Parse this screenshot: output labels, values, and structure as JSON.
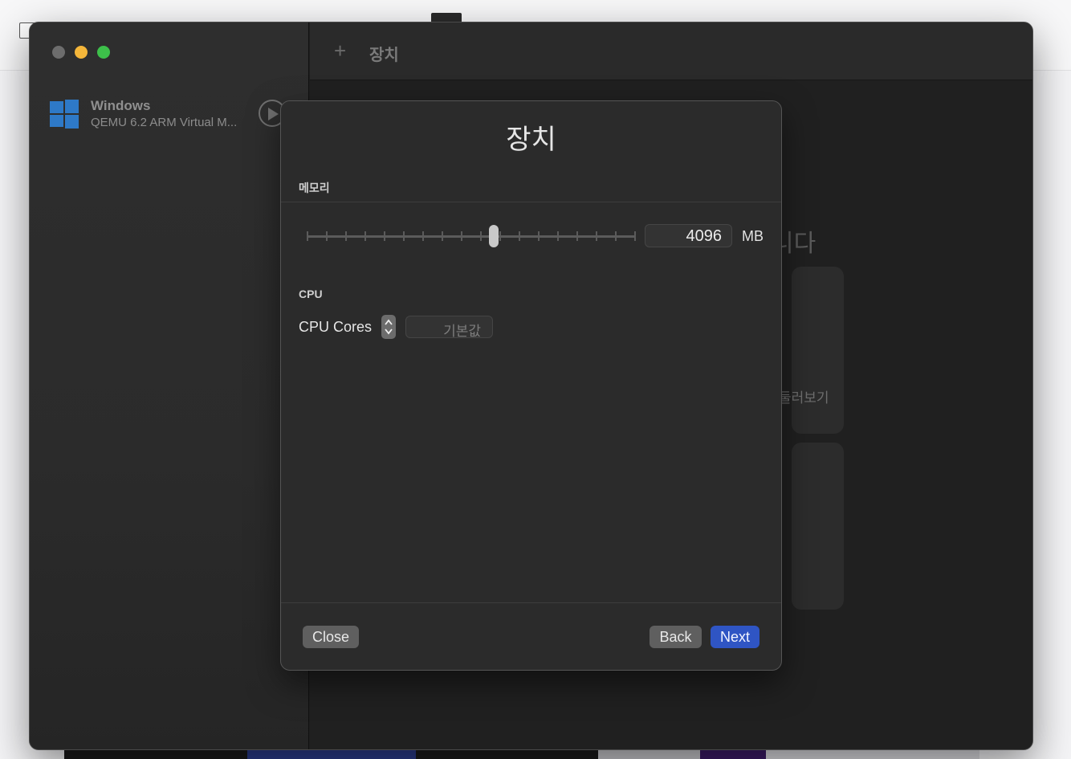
{
  "sidebar": {
    "vm": {
      "name": "Windows",
      "subtitle": "QEMU 6.2 ARM Virtual M..."
    }
  },
  "toolbar": {
    "title": "장치"
  },
  "background": {
    "heading_fragment": "니다",
    "card_text_fragment": "둘러보기"
  },
  "sheet": {
    "title": "장치",
    "memory": {
      "section_label": "메모리",
      "value": "4096",
      "unit": "MB",
      "slider_fraction": 0.57
    },
    "cpu": {
      "section_label": "CPU",
      "cores_label": "CPU Cores",
      "cores_placeholder": "기본값"
    },
    "buttons": {
      "close": "Close",
      "back": "Back",
      "next": "Next"
    }
  },
  "colors": {
    "accent": "#2f55c4",
    "traffic_close": "#6d6d6d",
    "traffic_minimize": "#f4b63a",
    "traffic_maximize": "#3dc04a",
    "windows_logo": "#2e79c7"
  }
}
